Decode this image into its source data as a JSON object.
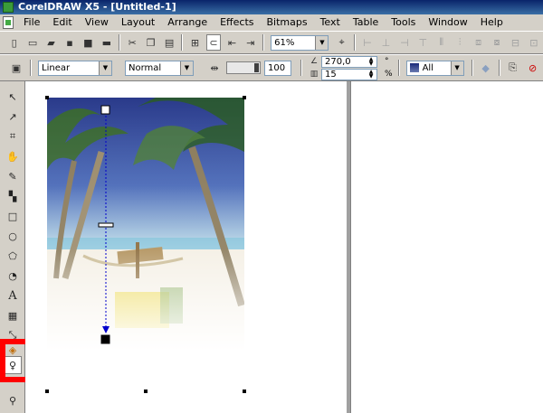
{
  "window": {
    "title": "CorelDRAW X5 - [Untitled-1]"
  },
  "menu": [
    "File",
    "Edit",
    "View",
    "Layout",
    "Arrange",
    "Effects",
    "Bitmaps",
    "Text",
    "Table",
    "Tools",
    "Window",
    "Help"
  ],
  "standard_toolbar": {
    "zoom_level": "61%"
  },
  "property_bar": {
    "transparency_type": "Linear",
    "merge_mode": "Normal",
    "midpoint_value": "100",
    "angle_value": "270,0",
    "angle_unit": "°",
    "edge_pad_value": "15",
    "edge_pad_unit": "%",
    "target_label": "All"
  },
  "colors": {
    "highlight": "#ff0000",
    "titlebar_start": "#0a246a",
    "titlebar_end": "#3a6ea5",
    "vector_line": "#0000cc"
  },
  "icons": {
    "toolbox": [
      "pick-tool-icon",
      "shape-tool-icon",
      "crop-tool-icon",
      "zoom-tool-icon",
      "freehand-tool-icon",
      "smart-fill-tool-icon",
      "rectangle-tool-icon",
      "ellipse-tool-icon",
      "polygon-tool-icon",
      "basic-shapes-tool-icon",
      "text-tool-icon",
      "table-tool-icon",
      "dimension-tool-icon",
      "interactive-fill-tool-icon",
      "transparency-tool-icon",
      "eyedropper-tool-icon"
    ]
  }
}
